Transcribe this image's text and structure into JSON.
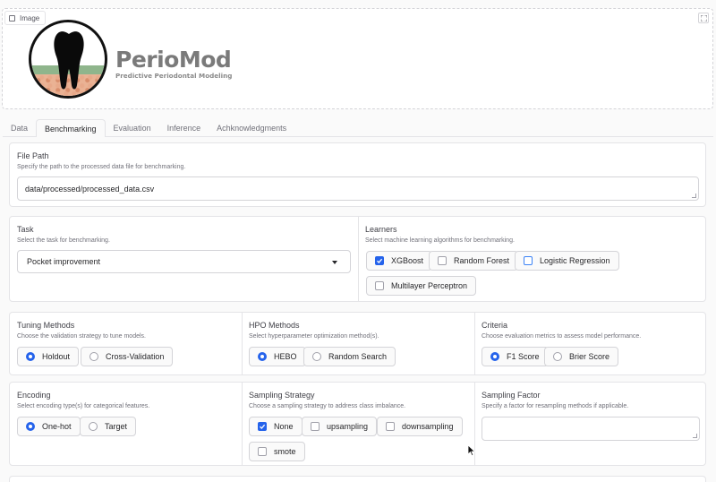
{
  "image_block": {
    "label": "Image"
  },
  "logo": {
    "name": "PerioMod",
    "tagline": "Predictive Periodontal Modeling"
  },
  "tabs": [
    {
      "label": "Data",
      "active": false
    },
    {
      "label": "Benchmarking",
      "active": true
    },
    {
      "label": "Evaluation",
      "active": false
    },
    {
      "label": "Inference",
      "active": false
    },
    {
      "label": "Achknowledgments",
      "active": false
    }
  ],
  "file_path": {
    "label": "File Path",
    "info": "Specify the path to the processed data file for benchmarking.",
    "value": "data/processed/processed_data.csv"
  },
  "task": {
    "label": "Task",
    "info": "Select the task for benchmarking.",
    "selected": "Pocket improvement"
  },
  "learners": {
    "label": "Learners",
    "info": "Select machine learning algorithms for benchmarking.",
    "options": [
      {
        "label": "XGBoost",
        "checked": true
      },
      {
        "label": "Random Forest",
        "checked": false
      },
      {
        "label": "Logistic Regression",
        "checked": false
      },
      {
        "label": "Multilayer Perceptron",
        "checked": false
      }
    ]
  },
  "tuning": {
    "label": "Tuning Methods",
    "info": "Choose the validation strategy to tune models.",
    "options": [
      {
        "label": "Holdout",
        "selected": true
      },
      {
        "label": "Cross-Validation",
        "selected": false
      }
    ]
  },
  "hpo": {
    "label": "HPO Methods",
    "info": "Select hyperparameter optimization method(s).",
    "options": [
      {
        "label": "HEBO",
        "selected": true
      },
      {
        "label": "Random Search",
        "selected": false
      }
    ]
  },
  "criteria": {
    "label": "Criteria",
    "info": "Choose evaluation metrics to assess model performance.",
    "options": [
      {
        "label": "F1 Score",
        "selected": true
      },
      {
        "label": "Brier Score",
        "selected": false
      }
    ]
  },
  "encoding": {
    "label": "Encoding",
    "info": "Select encoding type(s) for categorical features.",
    "options": [
      {
        "label": "One-hot",
        "selected": true
      },
      {
        "label": "Target",
        "selected": false
      }
    ]
  },
  "sampling": {
    "label": "Sampling Strategy",
    "info": "Choose a sampling strategy to address class imbalance.",
    "options": [
      {
        "label": "None",
        "checked": true
      },
      {
        "label": "upsampling",
        "checked": false
      },
      {
        "label": "downsampling",
        "checked": false
      },
      {
        "label": "smote",
        "checked": false
      }
    ]
  },
  "sampling_factor": {
    "label": "Sampling Factor",
    "info": "Specify a factor for resampling methods if applicable.",
    "value": ""
  },
  "colors": {
    "accent": "#2563eb",
    "border": "#e4e4e7",
    "logo_gray": "#7a7a7a"
  }
}
